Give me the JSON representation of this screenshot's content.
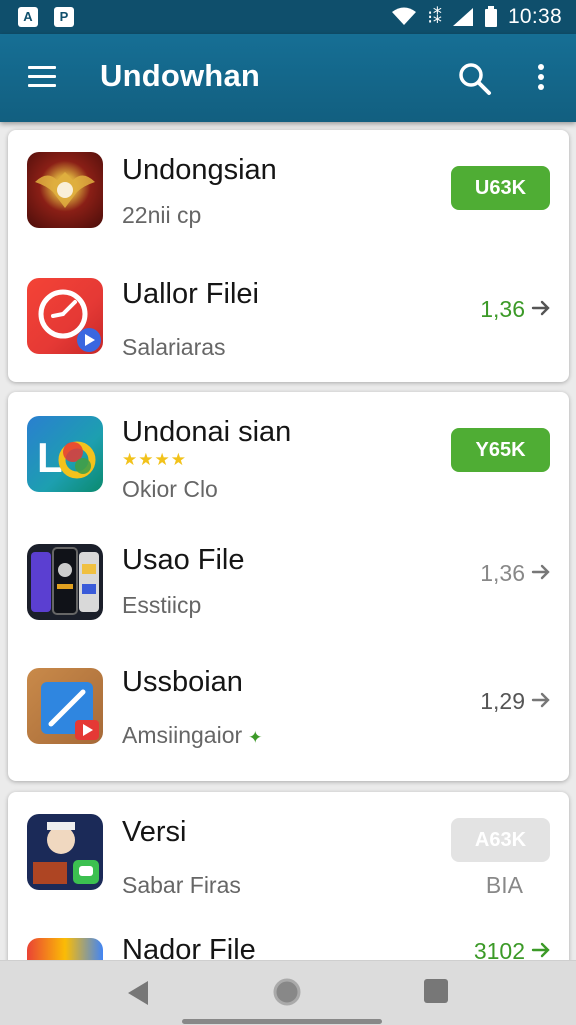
{
  "status_bar": {
    "left_icons": [
      "A",
      "P"
    ],
    "right_icons": [
      "wifi-icon",
      "vibrate-icon",
      "signal-icon",
      "battery-icon"
    ],
    "time": "10:38"
  },
  "app_bar": {
    "title": "Undowhan",
    "icons": [
      "menu-icon",
      "search-icon",
      "more-vert-icon"
    ]
  },
  "cards": [
    {
      "items": [
        {
          "name": "Undongsian",
          "subtitle": "22nii cp",
          "action": {
            "kind": "pill",
            "label": "U63K"
          }
        },
        {
          "name": "Uallor Filei",
          "subtitle": "Salariaras",
          "action": {
            "kind": "version",
            "label": "1,36"
          }
        }
      ]
    },
    {
      "items": [
        {
          "name": "Undonai sian",
          "stars": "★★★★",
          "subtitle": "Okior Clo",
          "action": {
            "kind": "pill",
            "label": "Y65K"
          }
        },
        {
          "name": "Usao File",
          "subtitle": "Esstiicp",
          "action": {
            "kind": "version",
            "label": "1,36"
          }
        },
        {
          "name": "Ussboian",
          "subtitle": "Amsiingaior",
          "action": {
            "kind": "version",
            "label": "1,29"
          }
        }
      ]
    },
    {
      "items": [
        {
          "name": "Versi",
          "subtitle": "Sabar Firas",
          "action": {
            "kind": "pill-grey",
            "label": "A63K"
          },
          "extra": "BIA"
        },
        {
          "name": "Nador File",
          "action": {
            "kind": "version",
            "label": "3102"
          }
        }
      ]
    }
  ],
  "colors": {
    "status_bar": "#0f4f6c",
    "app_bar": "#166f95",
    "accent_green": "#4fad34",
    "background": "#ebebeb"
  },
  "nav_bar": {
    "icons": [
      "back-icon",
      "home-icon",
      "recents-icon"
    ]
  }
}
